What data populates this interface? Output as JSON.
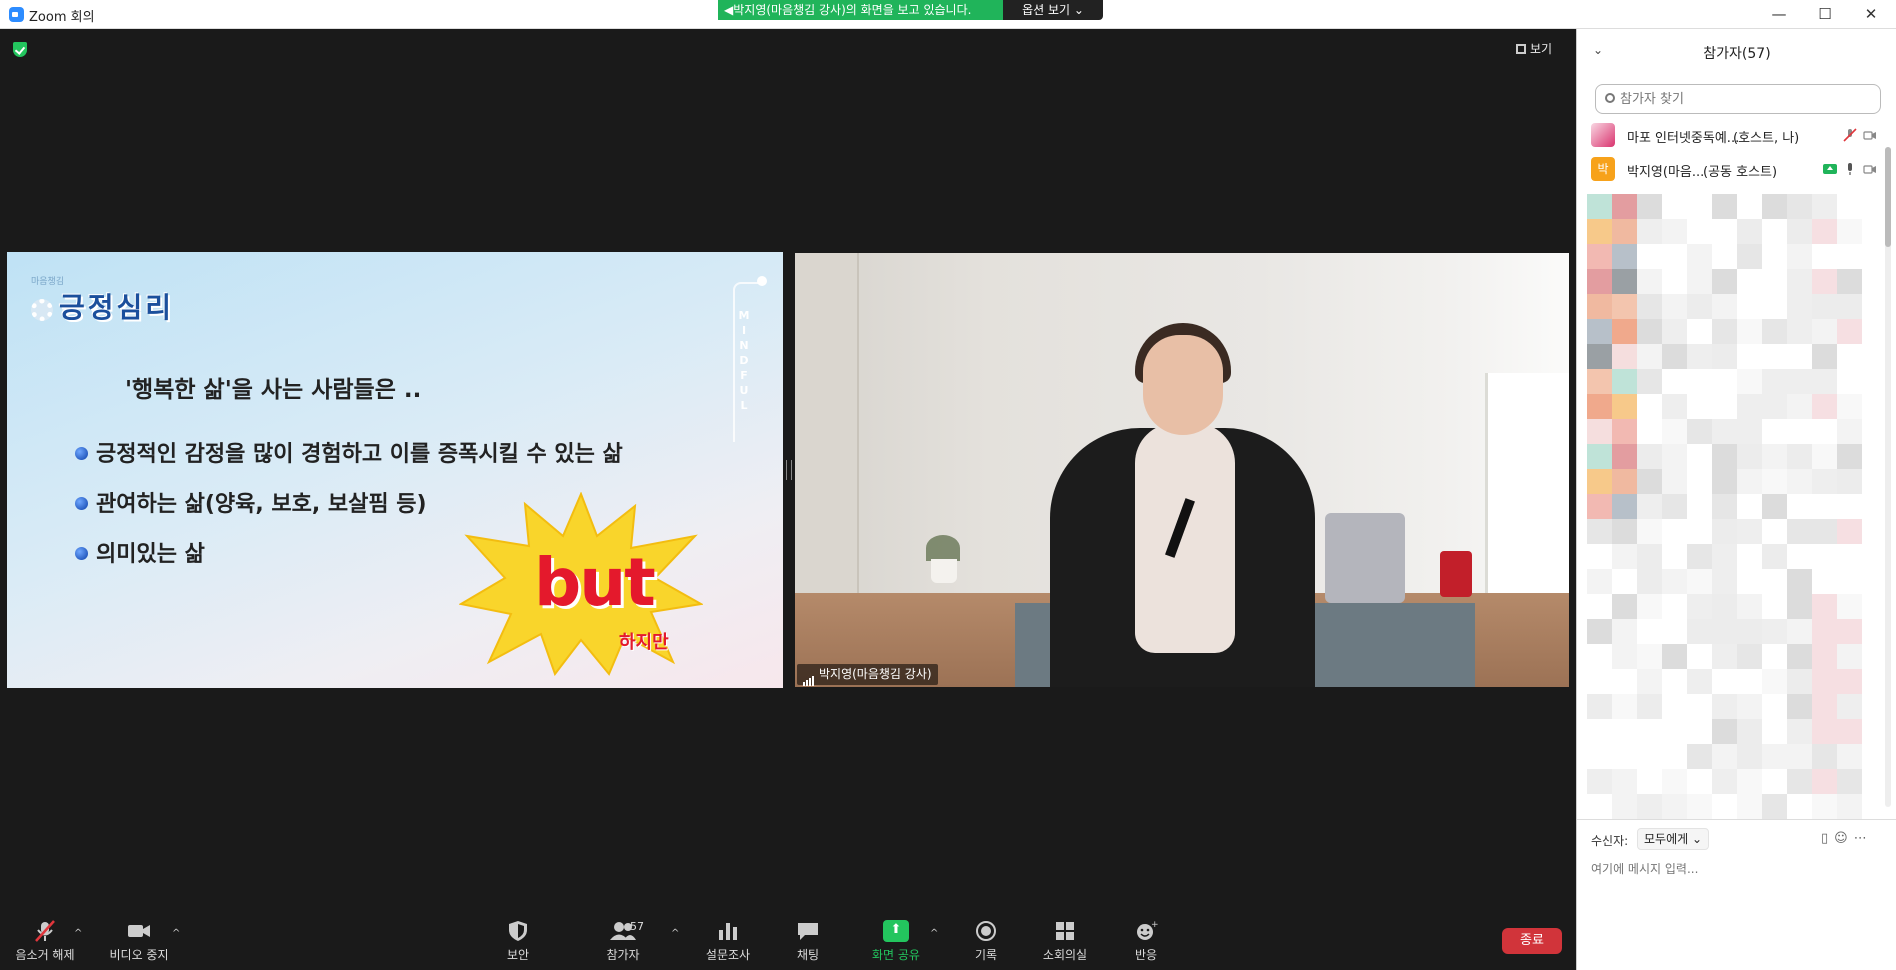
{
  "window": {
    "title": "Zoom 회의",
    "minimize": "—",
    "maximize": "☐",
    "close": "✕"
  },
  "share_banner": {
    "text": "박지영(마음챙김 강사)의 화면을 보고 있습니다.",
    "options_label": "옵션 보기"
  },
  "stage": {
    "view_label": "보기"
  },
  "slide": {
    "logo_text": "마음챙김",
    "title": "긍정심리",
    "subtitle": "'행복한 삶'을 사는 사람들은 ..",
    "bullets": [
      "긍정적인 감정을 많이 경험하고 이를 증폭시킬 수 있는 삶",
      "관여하는 삶(양육, 보호, 보살핌 등)",
      "의미있는 삶"
    ],
    "side_text": "MINDFUL",
    "burst_text": "but",
    "burst_subtext": "하지만"
  },
  "video": {
    "name_tag": "박지영(마음챙김 강사)"
  },
  "toolbar": {
    "unmute": "음소거 해제",
    "stop_video": "비디오 중지",
    "security": "보안",
    "participants": "참가자",
    "participants_count": "57",
    "polls": "설문조사",
    "chat": "채팅",
    "share_screen": "화면 공유",
    "record": "기록",
    "breakout": "소회의실",
    "reactions": "반응",
    "end": "종료"
  },
  "participants_panel": {
    "title": "참가자(57)",
    "search_placeholder": "참가자 찾기",
    "list": [
      {
        "name": "마포 인터넷중독예...",
        "role": "(호스트, 나)"
      },
      {
        "name": "박지영(마음...",
        "role": "(공동 호스트)",
        "avatar_letter": "박"
      }
    ]
  },
  "chat": {
    "to_label": "수신자:",
    "recipient": "모두에게",
    "placeholder": "여기에 메시지 입력..."
  },
  "colors": {
    "share_green": "#20b45a",
    "end_red": "#d1343a",
    "slide_title_blue": "#1b4f9c",
    "but_red": "#e4192c",
    "avatar_orange": "#f7a21b"
  }
}
